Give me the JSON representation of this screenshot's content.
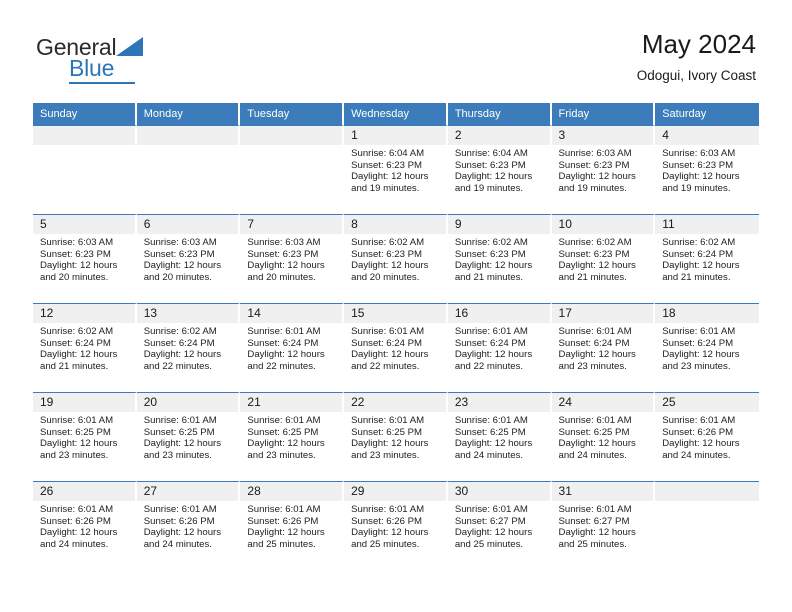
{
  "logo": {
    "word_one": "General",
    "word_two": "Blue",
    "triangle_color": "#2e75b6"
  },
  "header": {
    "title": "May 2024",
    "subtitle": "Odogui, Ivory Coast"
  },
  "theme": {
    "header_blue": "#3c7cba",
    "daynum_band": "#f0f0f0",
    "text": "#222222"
  },
  "calendar": {
    "weekday_headers": [
      "Sunday",
      "Monday",
      "Tuesday",
      "Wednesday",
      "Thursday",
      "Friday",
      "Saturday"
    ],
    "weeks": [
      [
        {
          "day": "",
          "empty": true
        },
        {
          "day": "",
          "empty": true
        },
        {
          "day": "",
          "empty": true
        },
        {
          "day": "1",
          "sunrise": "Sunrise: 6:04 AM",
          "sunset": "Sunset: 6:23 PM",
          "daylight_line1": "Daylight: 12 hours",
          "daylight_line2": "and 19 minutes."
        },
        {
          "day": "2",
          "sunrise": "Sunrise: 6:04 AM",
          "sunset": "Sunset: 6:23 PM",
          "daylight_line1": "Daylight: 12 hours",
          "daylight_line2": "and 19 minutes."
        },
        {
          "day": "3",
          "sunrise": "Sunrise: 6:03 AM",
          "sunset": "Sunset: 6:23 PM",
          "daylight_line1": "Daylight: 12 hours",
          "daylight_line2": "and 19 minutes."
        },
        {
          "day": "4",
          "sunrise": "Sunrise: 6:03 AM",
          "sunset": "Sunset: 6:23 PM",
          "daylight_line1": "Daylight: 12 hours",
          "daylight_line2": "and 19 minutes."
        }
      ],
      [
        {
          "day": "5",
          "sunrise": "Sunrise: 6:03 AM",
          "sunset": "Sunset: 6:23 PM",
          "daylight_line1": "Daylight: 12 hours",
          "daylight_line2": "and 20 minutes."
        },
        {
          "day": "6",
          "sunrise": "Sunrise: 6:03 AM",
          "sunset": "Sunset: 6:23 PM",
          "daylight_line1": "Daylight: 12 hours",
          "daylight_line2": "and 20 minutes."
        },
        {
          "day": "7",
          "sunrise": "Sunrise: 6:03 AM",
          "sunset": "Sunset: 6:23 PM",
          "daylight_line1": "Daylight: 12 hours",
          "daylight_line2": "and 20 minutes."
        },
        {
          "day": "8",
          "sunrise": "Sunrise: 6:02 AM",
          "sunset": "Sunset: 6:23 PM",
          "daylight_line1": "Daylight: 12 hours",
          "daylight_line2": "and 20 minutes."
        },
        {
          "day": "9",
          "sunrise": "Sunrise: 6:02 AM",
          "sunset": "Sunset: 6:23 PM",
          "daylight_line1": "Daylight: 12 hours",
          "daylight_line2": "and 21 minutes."
        },
        {
          "day": "10",
          "sunrise": "Sunrise: 6:02 AM",
          "sunset": "Sunset: 6:23 PM",
          "daylight_line1": "Daylight: 12 hours",
          "daylight_line2": "and 21 minutes."
        },
        {
          "day": "11",
          "sunrise": "Sunrise: 6:02 AM",
          "sunset": "Sunset: 6:24 PM",
          "daylight_line1": "Daylight: 12 hours",
          "daylight_line2": "and 21 minutes."
        }
      ],
      [
        {
          "day": "12",
          "sunrise": "Sunrise: 6:02 AM",
          "sunset": "Sunset: 6:24 PM",
          "daylight_line1": "Daylight: 12 hours",
          "daylight_line2": "and 21 minutes."
        },
        {
          "day": "13",
          "sunrise": "Sunrise: 6:02 AM",
          "sunset": "Sunset: 6:24 PM",
          "daylight_line1": "Daylight: 12 hours",
          "daylight_line2": "and 22 minutes."
        },
        {
          "day": "14",
          "sunrise": "Sunrise: 6:01 AM",
          "sunset": "Sunset: 6:24 PM",
          "daylight_line1": "Daylight: 12 hours",
          "daylight_line2": "and 22 minutes."
        },
        {
          "day": "15",
          "sunrise": "Sunrise: 6:01 AM",
          "sunset": "Sunset: 6:24 PM",
          "daylight_line1": "Daylight: 12 hours",
          "daylight_line2": "and 22 minutes."
        },
        {
          "day": "16",
          "sunrise": "Sunrise: 6:01 AM",
          "sunset": "Sunset: 6:24 PM",
          "daylight_line1": "Daylight: 12 hours",
          "daylight_line2": "and 22 minutes."
        },
        {
          "day": "17",
          "sunrise": "Sunrise: 6:01 AM",
          "sunset": "Sunset: 6:24 PM",
          "daylight_line1": "Daylight: 12 hours",
          "daylight_line2": "and 23 minutes."
        },
        {
          "day": "18",
          "sunrise": "Sunrise: 6:01 AM",
          "sunset": "Sunset: 6:24 PM",
          "daylight_line1": "Daylight: 12 hours",
          "daylight_line2": "and 23 minutes."
        }
      ],
      [
        {
          "day": "19",
          "sunrise": "Sunrise: 6:01 AM",
          "sunset": "Sunset: 6:25 PM",
          "daylight_line1": "Daylight: 12 hours",
          "daylight_line2": "and 23 minutes."
        },
        {
          "day": "20",
          "sunrise": "Sunrise: 6:01 AM",
          "sunset": "Sunset: 6:25 PM",
          "daylight_line1": "Daylight: 12 hours",
          "daylight_line2": "and 23 minutes."
        },
        {
          "day": "21",
          "sunrise": "Sunrise: 6:01 AM",
          "sunset": "Sunset: 6:25 PM",
          "daylight_line1": "Daylight: 12 hours",
          "daylight_line2": "and 23 minutes."
        },
        {
          "day": "22",
          "sunrise": "Sunrise: 6:01 AM",
          "sunset": "Sunset: 6:25 PM",
          "daylight_line1": "Daylight: 12 hours",
          "daylight_line2": "and 23 minutes."
        },
        {
          "day": "23",
          "sunrise": "Sunrise: 6:01 AM",
          "sunset": "Sunset: 6:25 PM",
          "daylight_line1": "Daylight: 12 hours",
          "daylight_line2": "and 24 minutes."
        },
        {
          "day": "24",
          "sunrise": "Sunrise: 6:01 AM",
          "sunset": "Sunset: 6:25 PM",
          "daylight_line1": "Daylight: 12 hours",
          "daylight_line2": "and 24 minutes."
        },
        {
          "day": "25",
          "sunrise": "Sunrise: 6:01 AM",
          "sunset": "Sunset: 6:26 PM",
          "daylight_line1": "Daylight: 12 hours",
          "daylight_line2": "and 24 minutes."
        }
      ],
      [
        {
          "day": "26",
          "sunrise": "Sunrise: 6:01 AM",
          "sunset": "Sunset: 6:26 PM",
          "daylight_line1": "Daylight: 12 hours",
          "daylight_line2": "and 24 minutes."
        },
        {
          "day": "27",
          "sunrise": "Sunrise: 6:01 AM",
          "sunset": "Sunset: 6:26 PM",
          "daylight_line1": "Daylight: 12 hours",
          "daylight_line2": "and 24 minutes."
        },
        {
          "day": "28",
          "sunrise": "Sunrise: 6:01 AM",
          "sunset": "Sunset: 6:26 PM",
          "daylight_line1": "Daylight: 12 hours",
          "daylight_line2": "and 25 minutes."
        },
        {
          "day": "29",
          "sunrise": "Sunrise: 6:01 AM",
          "sunset": "Sunset: 6:26 PM",
          "daylight_line1": "Daylight: 12 hours",
          "daylight_line2": "and 25 minutes."
        },
        {
          "day": "30",
          "sunrise": "Sunrise: 6:01 AM",
          "sunset": "Sunset: 6:27 PM",
          "daylight_line1": "Daylight: 12 hours",
          "daylight_line2": "and 25 minutes."
        },
        {
          "day": "31",
          "sunrise": "Sunrise: 6:01 AM",
          "sunset": "Sunset: 6:27 PM",
          "daylight_line1": "Daylight: 12 hours",
          "daylight_line2": "and 25 minutes."
        },
        {
          "day": "",
          "empty": true
        }
      ]
    ]
  }
}
